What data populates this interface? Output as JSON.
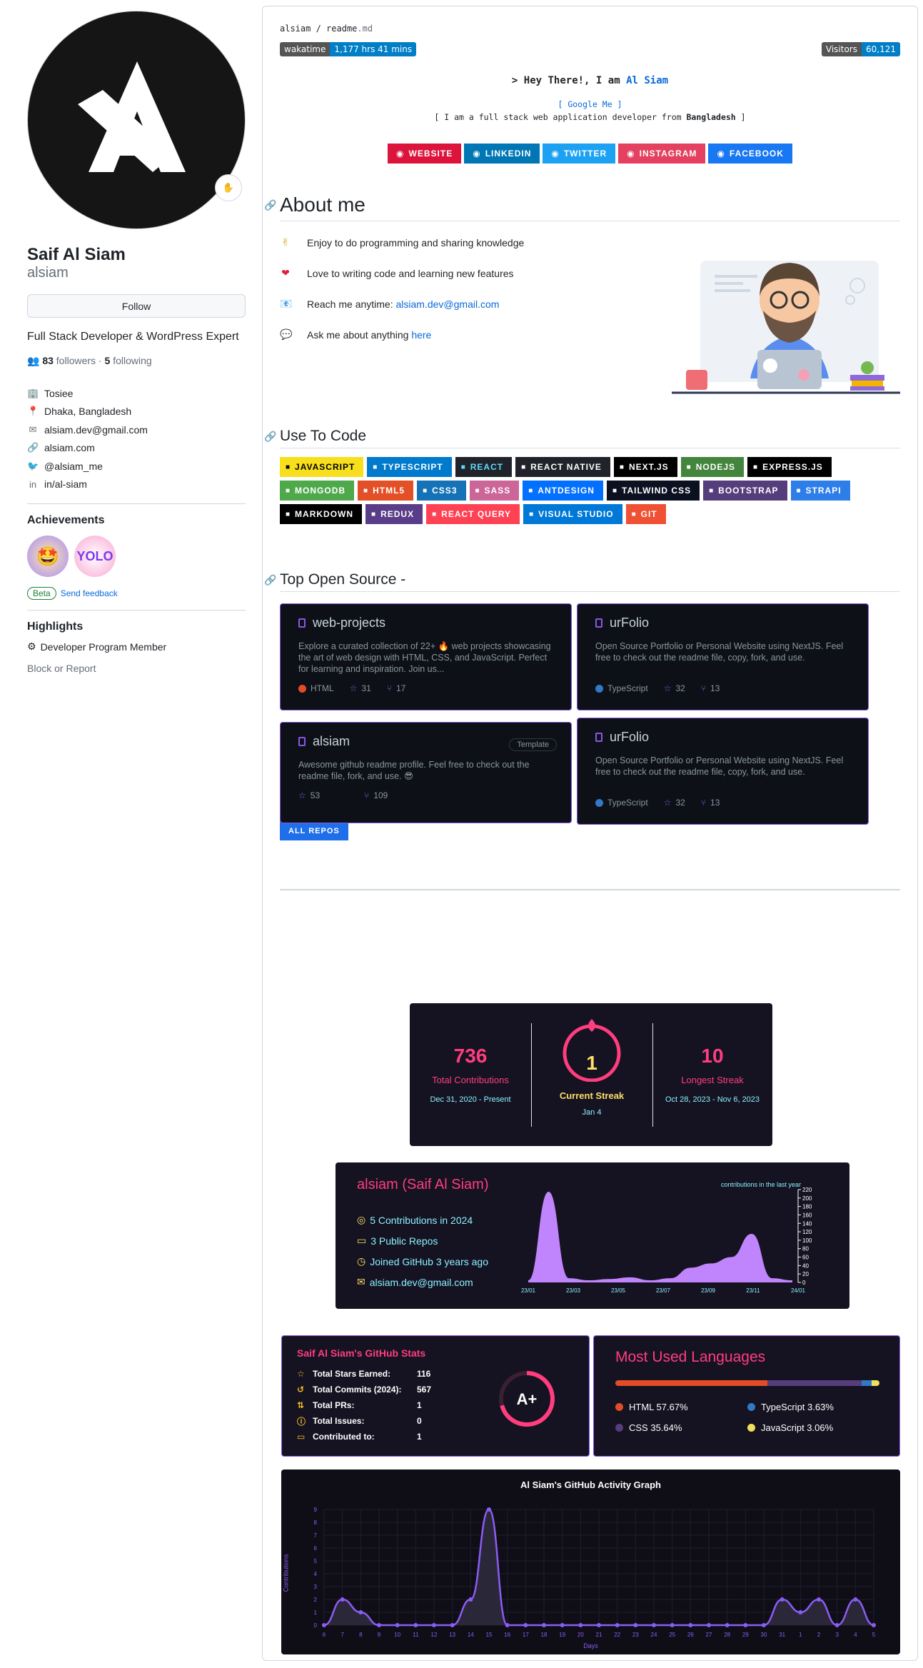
{
  "profile": {
    "name": "Saif Al Siam",
    "login": "alsiam",
    "follow_label": "Follow",
    "bio": "Full Stack Developer & WordPress Expert",
    "followers": "83",
    "followers_label": "followers",
    "following": "5",
    "following_label": "following",
    "details": [
      {
        "icon": "org-icon",
        "text": "Tosiee"
      },
      {
        "icon": "location-icon",
        "text": "Dhaka, Bangladesh"
      },
      {
        "icon": "mail-icon",
        "text": "alsiam.dev@gmail.com"
      },
      {
        "icon": "link-icon",
        "text": "alsiam.com"
      },
      {
        "icon": "twitter-icon",
        "text": "@alsiam_me"
      },
      {
        "icon": "linkedin-icon",
        "text": "in/al-siam"
      }
    ],
    "achievements_title": "Achievements",
    "beta": "Beta",
    "feedback": "Send feedback",
    "highlights_title": "Highlights",
    "highlight": "Developer Program Member",
    "block": "Block or Report"
  },
  "readme": {
    "crumb_user": "alsiam",
    "crumb_file": "readme",
    "crumb_ext": ".md",
    "wakatime_label": "wakatime",
    "wakatime_value": "1,177 hrs 41 mins",
    "visitors_label": "Visitors",
    "visitors_value": "60,121",
    "hey_prefix": "> Hey There!, I am ",
    "hey_name": "Al Siam",
    "google": "[ Google Me ]",
    "tagline_pre": "[ I am a full stack web application developer from ",
    "tagline_bold": "Bangladesh",
    "tagline_post": " ]",
    "social": [
      {
        "label": "WEBSITE",
        "color": "#dc143c"
      },
      {
        "label": "LINKEDIN",
        "color": "#0077b5"
      },
      {
        "label": "TWITTER",
        "color": "#1da1f2"
      },
      {
        "label": "INSTAGRAM",
        "color": "#e4405f"
      },
      {
        "label": "FACEBOOK",
        "color": "#1877f2"
      }
    ],
    "about_title": "About me",
    "about": [
      {
        "emoji": "✌",
        "text": "Enjoy to do programming and sharing knowledge"
      },
      {
        "emoji": "❤",
        "text": "Love to writing code and learning new features"
      },
      {
        "emoji": "📧",
        "text": "Reach me anytime: ",
        "link": "alsiam.dev@gmail.com"
      },
      {
        "emoji": "💬",
        "text": "Ask me about anything ",
        "link": "here"
      }
    ],
    "code_title": "Use To Code",
    "tech": [
      {
        "label": "JAVASCRIPT",
        "bg": "#f7df1e",
        "fg": "#000"
      },
      {
        "label": "TYPESCRIPT",
        "bg": "#007acc",
        "fg": "#fff"
      },
      {
        "label": "REACT",
        "bg": "#20232a",
        "fg": "#61dafb",
        "split": "#61dafb"
      },
      {
        "label": "REACT NATIVE",
        "bg": "#20232a",
        "fg": "#fff"
      },
      {
        "label": "NEXT.JS",
        "bg": "#000",
        "fg": "#fff"
      },
      {
        "label": "NODEJS",
        "bg": "#43853d",
        "fg": "#fff"
      },
      {
        "label": "EXPRESS.JS",
        "bg": "#000",
        "fg": "#fff"
      },
      {
        "label": "MONGODB",
        "bg": "#4ea94b",
        "fg": "#fff"
      },
      {
        "label": "HTML5",
        "bg": "#e34f26",
        "fg": "#fff"
      },
      {
        "label": "CSS3",
        "bg": "#1572b6",
        "fg": "#fff"
      },
      {
        "label": "SASS",
        "bg": "#cc6699",
        "fg": "#fff"
      },
      {
        "label": "ANTDESIGN",
        "bg": "#0170fe",
        "fg": "#fff"
      },
      {
        "label": "TAILWIND CSS",
        "bg": "#0b1120",
        "fg": "#fff"
      },
      {
        "label": "BOOTSTRAP",
        "bg": "#563d7c",
        "fg": "#fff"
      },
      {
        "label": "STRAPI",
        "bg": "#2e7eea",
        "fg": "#fff"
      },
      {
        "label": "MARKDOWN",
        "bg": "#000",
        "fg": "#fff"
      },
      {
        "label": "REDUX",
        "bg": "#593d88",
        "fg": "#fff"
      },
      {
        "label": "REACT QUERY",
        "bg": "#ff4154",
        "fg": "#fff"
      },
      {
        "label": "VISUAL STUDIO",
        "bg": "#0078d7",
        "fg": "#fff"
      },
      {
        "label": "GIT",
        "bg": "#f05033",
        "fg": "#fff"
      }
    ],
    "os_title": "Top Open Source -",
    "repos": [
      {
        "name": "web-projects",
        "desc": "Explore a curated collection of 22+ 🔥 web projects showcasing the art of web design with HTML, CSS, and JavaScript. Perfect for learning and inspiration. Join us...",
        "lang": "HTML",
        "lang_color": "#e34c26",
        "stars": "31",
        "forks": "17"
      },
      {
        "name": "urFolio",
        "desc": "Open Source Portfolio or Personal Website using NextJS. Feel free to check out the readme file, copy, fork, and use.",
        "lang": "TypeScript",
        "lang_color": "#3178c6",
        "stars": "32",
        "forks": "13"
      },
      {
        "name": "alsiam",
        "desc": "Awesome github readme profile. Feel free to check out the readme file, fork, and use. 😎",
        "lang": "",
        "lang_color": "",
        "stars": "53",
        "forks": "109",
        "template": "Template"
      },
      {
        "name": "urFolio",
        "desc": "Open Source Portfolio or Personal Website using NextJS. Feel free to check out the readme file, copy, fork, and use.",
        "lang": "TypeScript",
        "lang_color": "#3178c6",
        "stars": "32",
        "forks": "13"
      }
    ],
    "all_repos": "ALL REPOS"
  },
  "streak": {
    "total": "736",
    "total_label": "Total Contributions",
    "total_range": "Dec 31, 2020 - Present",
    "current": "1",
    "current_label": "Current Streak",
    "current_date": "Jan 4",
    "longest": "10",
    "longest_label": "Longest Streak",
    "longest_range": "Oct 28, 2023 - Nov 6, 2023"
  },
  "summary": {
    "title": "alsiam (Saif Al Siam)",
    "lines": [
      "5 Contributions in 2024",
      "3 Public Repos",
      "Joined GitHub 3 years ago",
      "alsiam.dev@gmail.com"
    ],
    "chart_label": "contributions in the last year",
    "chart_data": {
      "type": "area",
      "x": [
        "23/01",
        "23/03",
        "23/05",
        "23/07",
        "23/09",
        "23/11",
        "24/01"
      ],
      "yticks": [
        0,
        20,
        40,
        60,
        80,
        100,
        120,
        140,
        160,
        180,
        200,
        220
      ],
      "ylim": [
        0,
        220
      ],
      "values": [
        5,
        215,
        10,
        5,
        8,
        12,
        5,
        10,
        35,
        45,
        60,
        115,
        10,
        5
      ]
    }
  },
  "stats": {
    "title": "Saif Al Siam's GitHub Stats",
    "rows": [
      {
        "label": "Total Stars Earned:",
        "value": "116"
      },
      {
        "label": "Total Commits (2024):",
        "value": "567"
      },
      {
        "label": "Total PRs:",
        "value": "1"
      },
      {
        "label": "Total Issues:",
        "value": "0"
      },
      {
        "label": "Contributed to:",
        "value": "1"
      }
    ],
    "grade": "A+"
  },
  "langs": {
    "title": "Most Used Languages",
    "items": [
      {
        "name": "HTML",
        "pct": 57.67,
        "label": "HTML 57.67%",
        "color": "#e34c26"
      },
      {
        "name": "CSS",
        "pct": 35.64,
        "label": "CSS 35.64%",
        "color": "#563d7c"
      },
      {
        "name": "TypeScript",
        "pct": 3.63,
        "label": "TypeScript 3.63%",
        "color": "#3178c6"
      },
      {
        "name": "JavaScript",
        "pct": 3.06,
        "label": "JavaScript 3.06%",
        "color": "#f1e05a"
      }
    ]
  },
  "activity": {
    "title": "Al Siam's GitHub Activity Graph",
    "ylabel": "Contributions",
    "xlabel": "Days",
    "chart_data": {
      "type": "line",
      "x": [
        "6",
        "7",
        "8",
        "9",
        "10",
        "11",
        "12",
        "13",
        "14",
        "15",
        "16",
        "17",
        "18",
        "19",
        "20",
        "21",
        "22",
        "23",
        "24",
        "25",
        "26",
        "27",
        "28",
        "29",
        "30",
        "31",
        "1",
        "2",
        "3",
        "4",
        "5"
      ],
      "values": [
        0,
        2,
        1,
        0,
        0,
        0,
        0,
        0,
        2,
        9,
        0,
        0,
        0,
        0,
        0,
        0,
        0,
        0,
        0,
        0,
        0,
        0,
        0,
        0,
        0,
        2,
        1,
        2,
        0,
        2,
        0
      ],
      "ylim": [
        0,
        9
      ],
      "yticks": [
        0,
        1,
        2,
        3,
        4,
        5,
        6,
        7,
        8,
        9
      ]
    }
  }
}
